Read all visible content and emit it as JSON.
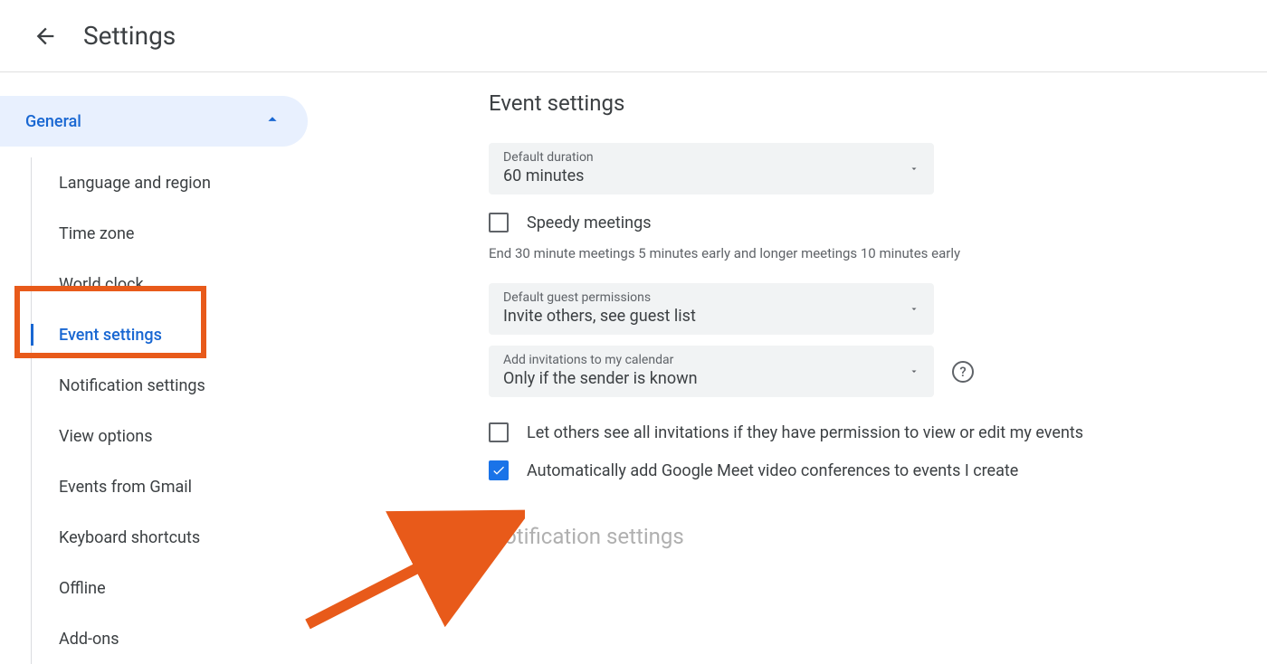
{
  "header": {
    "title": "Settings"
  },
  "sidebar": {
    "section_label": "General",
    "items": [
      {
        "label": "Language and region",
        "selected": false
      },
      {
        "label": "Time zone",
        "selected": false
      },
      {
        "label": "World clock",
        "selected": false
      },
      {
        "label": "Event settings",
        "selected": true
      },
      {
        "label": "Notification settings",
        "selected": false
      },
      {
        "label": "View options",
        "selected": false
      },
      {
        "label": "Events from Gmail",
        "selected": false
      },
      {
        "label": "Keyboard shortcuts",
        "selected": false
      },
      {
        "label": "Offline",
        "selected": false
      },
      {
        "label": "Add-ons",
        "selected": false
      }
    ]
  },
  "main": {
    "section_title": "Event settings",
    "default_duration": {
      "label": "Default duration",
      "value": "60 minutes"
    },
    "speedy_meetings": {
      "label": "Speedy meetings",
      "checked": false
    },
    "speedy_helper": "End 30 minute meetings 5 minutes early and longer meetings 10 minutes early",
    "guest_permissions": {
      "label": "Default guest permissions",
      "value": "Invite others, see guest list"
    },
    "add_invitations": {
      "label": "Add invitations to my calendar",
      "value": "Only if the sender is known"
    },
    "see_all_invitations": {
      "label": "Let others see all invitations if they have permission to view or edit my events",
      "checked": false
    },
    "auto_add_meet": {
      "label": "Automatically add Google Meet video conferences to events I create",
      "checked": true
    },
    "next_section": "Notification settings"
  },
  "annotation": {
    "highlight_target": "Event settings",
    "arrow_target": "Automatically add Google Meet checkbox"
  }
}
